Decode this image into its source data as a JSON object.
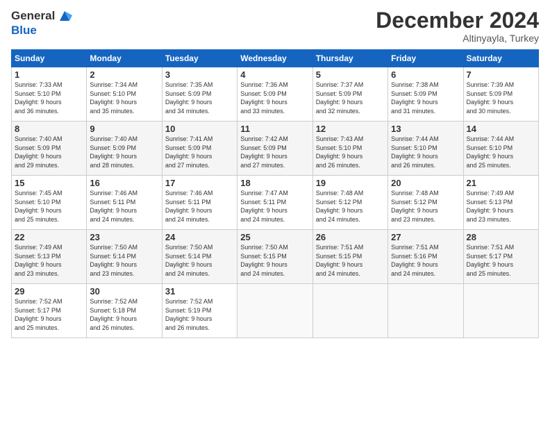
{
  "header": {
    "logo_line1": "General",
    "logo_line2": "Blue",
    "month": "December 2024",
    "location": "Altinyayla, Turkey"
  },
  "weekdays": [
    "Sunday",
    "Monday",
    "Tuesday",
    "Wednesday",
    "Thursday",
    "Friday",
    "Saturday"
  ],
  "weeks": [
    [
      {
        "day": "1",
        "lines": [
          "Sunrise: 7:33 AM",
          "Sunset: 5:10 PM",
          "Daylight: 9 hours",
          "and 36 minutes."
        ]
      },
      {
        "day": "2",
        "lines": [
          "Sunrise: 7:34 AM",
          "Sunset: 5:10 PM",
          "Daylight: 9 hours",
          "and 35 minutes."
        ]
      },
      {
        "day": "3",
        "lines": [
          "Sunrise: 7:35 AM",
          "Sunset: 5:09 PM",
          "Daylight: 9 hours",
          "and 34 minutes."
        ]
      },
      {
        "day": "4",
        "lines": [
          "Sunrise: 7:36 AM",
          "Sunset: 5:09 PM",
          "Daylight: 9 hours",
          "and 33 minutes."
        ]
      },
      {
        "day": "5",
        "lines": [
          "Sunrise: 7:37 AM",
          "Sunset: 5:09 PM",
          "Daylight: 9 hours",
          "and 32 minutes."
        ]
      },
      {
        "day": "6",
        "lines": [
          "Sunrise: 7:38 AM",
          "Sunset: 5:09 PM",
          "Daylight: 9 hours",
          "and 31 minutes."
        ]
      },
      {
        "day": "7",
        "lines": [
          "Sunrise: 7:39 AM",
          "Sunset: 5:09 PM",
          "Daylight: 9 hours",
          "and 30 minutes."
        ]
      }
    ],
    [
      {
        "day": "8",
        "lines": [
          "Sunrise: 7:40 AM",
          "Sunset: 5:09 PM",
          "Daylight: 9 hours",
          "and 29 minutes."
        ]
      },
      {
        "day": "9",
        "lines": [
          "Sunrise: 7:40 AM",
          "Sunset: 5:09 PM",
          "Daylight: 9 hours",
          "and 28 minutes."
        ]
      },
      {
        "day": "10",
        "lines": [
          "Sunrise: 7:41 AM",
          "Sunset: 5:09 PM",
          "Daylight: 9 hours",
          "and 27 minutes."
        ]
      },
      {
        "day": "11",
        "lines": [
          "Sunrise: 7:42 AM",
          "Sunset: 5:09 PM",
          "Daylight: 9 hours",
          "and 27 minutes."
        ]
      },
      {
        "day": "12",
        "lines": [
          "Sunrise: 7:43 AM",
          "Sunset: 5:10 PM",
          "Daylight: 9 hours",
          "and 26 minutes."
        ]
      },
      {
        "day": "13",
        "lines": [
          "Sunrise: 7:44 AM",
          "Sunset: 5:10 PM",
          "Daylight: 9 hours",
          "and 26 minutes."
        ]
      },
      {
        "day": "14",
        "lines": [
          "Sunrise: 7:44 AM",
          "Sunset: 5:10 PM",
          "Daylight: 9 hours",
          "and 25 minutes."
        ]
      }
    ],
    [
      {
        "day": "15",
        "lines": [
          "Sunrise: 7:45 AM",
          "Sunset: 5:10 PM",
          "Daylight: 9 hours",
          "and 25 minutes."
        ]
      },
      {
        "day": "16",
        "lines": [
          "Sunrise: 7:46 AM",
          "Sunset: 5:11 PM",
          "Daylight: 9 hours",
          "and 24 minutes."
        ]
      },
      {
        "day": "17",
        "lines": [
          "Sunrise: 7:46 AM",
          "Sunset: 5:11 PM",
          "Daylight: 9 hours",
          "and 24 minutes."
        ]
      },
      {
        "day": "18",
        "lines": [
          "Sunrise: 7:47 AM",
          "Sunset: 5:11 PM",
          "Daylight: 9 hours",
          "and 24 minutes."
        ]
      },
      {
        "day": "19",
        "lines": [
          "Sunrise: 7:48 AM",
          "Sunset: 5:12 PM",
          "Daylight: 9 hours",
          "and 24 minutes."
        ]
      },
      {
        "day": "20",
        "lines": [
          "Sunrise: 7:48 AM",
          "Sunset: 5:12 PM",
          "Daylight: 9 hours",
          "and 23 minutes."
        ]
      },
      {
        "day": "21",
        "lines": [
          "Sunrise: 7:49 AM",
          "Sunset: 5:13 PM",
          "Daylight: 9 hours",
          "and 23 minutes."
        ]
      }
    ],
    [
      {
        "day": "22",
        "lines": [
          "Sunrise: 7:49 AM",
          "Sunset: 5:13 PM",
          "Daylight: 9 hours",
          "and 23 minutes."
        ]
      },
      {
        "day": "23",
        "lines": [
          "Sunrise: 7:50 AM",
          "Sunset: 5:14 PM",
          "Daylight: 9 hours",
          "and 23 minutes."
        ]
      },
      {
        "day": "24",
        "lines": [
          "Sunrise: 7:50 AM",
          "Sunset: 5:14 PM",
          "Daylight: 9 hours",
          "and 24 minutes."
        ]
      },
      {
        "day": "25",
        "lines": [
          "Sunrise: 7:50 AM",
          "Sunset: 5:15 PM",
          "Daylight: 9 hours",
          "and 24 minutes."
        ]
      },
      {
        "day": "26",
        "lines": [
          "Sunrise: 7:51 AM",
          "Sunset: 5:15 PM",
          "Daylight: 9 hours",
          "and 24 minutes."
        ]
      },
      {
        "day": "27",
        "lines": [
          "Sunrise: 7:51 AM",
          "Sunset: 5:16 PM",
          "Daylight: 9 hours",
          "and 24 minutes."
        ]
      },
      {
        "day": "28",
        "lines": [
          "Sunrise: 7:51 AM",
          "Sunset: 5:17 PM",
          "Daylight: 9 hours",
          "and 25 minutes."
        ]
      }
    ],
    [
      {
        "day": "29",
        "lines": [
          "Sunrise: 7:52 AM",
          "Sunset: 5:17 PM",
          "Daylight: 9 hours",
          "and 25 minutes."
        ]
      },
      {
        "day": "30",
        "lines": [
          "Sunrise: 7:52 AM",
          "Sunset: 5:18 PM",
          "Daylight: 9 hours",
          "and 26 minutes."
        ]
      },
      {
        "day": "31",
        "lines": [
          "Sunrise: 7:52 AM",
          "Sunset: 5:19 PM",
          "Daylight: 9 hours",
          "and 26 minutes."
        ]
      },
      null,
      null,
      null,
      null
    ]
  ]
}
